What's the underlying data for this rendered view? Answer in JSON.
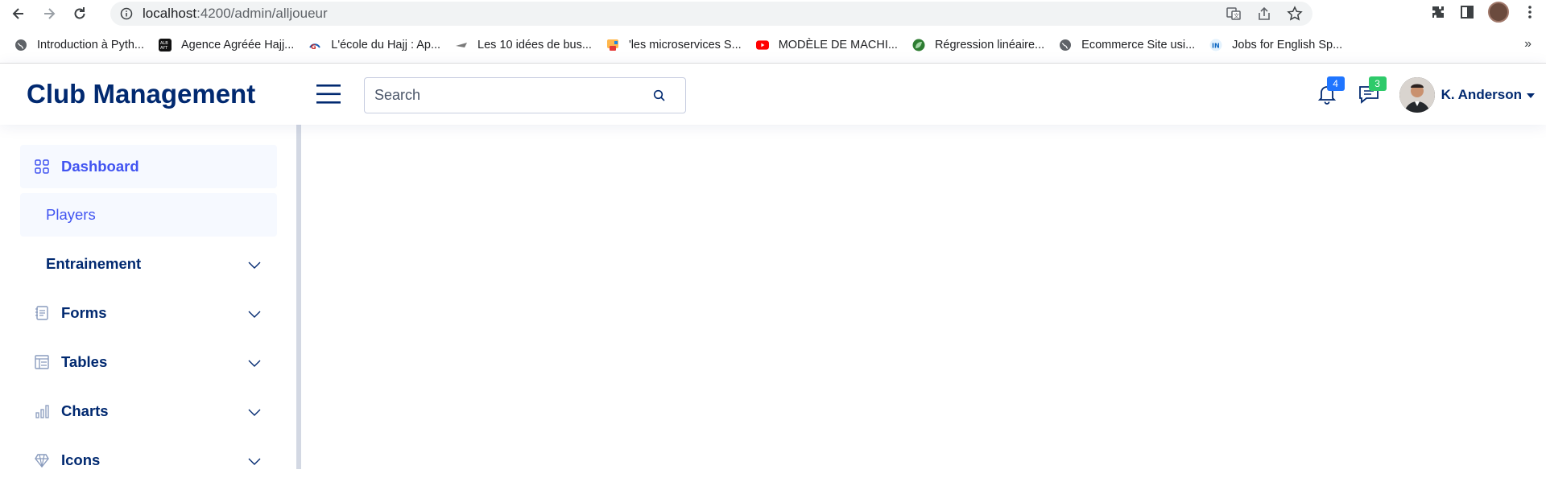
{
  "browser": {
    "url_host": "localhost",
    "url_rest": ":4200/admin/alljoueur",
    "bookmarks": [
      {
        "label": "Introduction à Pyth...",
        "icon": "globe-icon",
        "color": "#5f6368"
      },
      {
        "label": "Agence Agréée Hajj...",
        "icon": "alb-icon",
        "color": "#111111"
      },
      {
        "label": "L'école du Hajj : Ap...",
        "icon": "hajj-icon",
        "color": "#1a5fb4"
      },
      {
        "label": "Les 10 idées de bus...",
        "icon": "plane-icon",
        "color": "#7a7a7a"
      },
      {
        "label": "'les microservices S...",
        "icon": "slides-icon",
        "color": "#f57c00"
      },
      {
        "label": "MODÈLE DE MACHI...",
        "icon": "youtube-icon",
        "color": "#ff0000"
      },
      {
        "label": "Régression linéaire...",
        "icon": "leaf-icon",
        "color": "#2e7d32"
      },
      {
        "label": "Ecommerce Site usi...",
        "icon": "globe-icon",
        "color": "#5f6368"
      },
      {
        "label": "Jobs for English Sp...",
        "icon": "in-icon",
        "color": "#0a66c2"
      }
    ],
    "more": "»"
  },
  "header": {
    "logo": "Club Management",
    "search_placeholder": "Search",
    "notifications_count": "4",
    "messages_count": "3",
    "user_name": "K. Anderson"
  },
  "sidebar": {
    "items": [
      {
        "label": "Dashboard",
        "icon": "grid-icon"
      },
      {
        "label": "Players"
      },
      {
        "label": "Entrainement"
      },
      {
        "label": "Forms",
        "icon": "journal-icon"
      },
      {
        "label": "Tables",
        "icon": "table-icon"
      },
      {
        "label": "Charts",
        "icon": "bar-chart-icon"
      },
      {
        "label": "Icons",
        "icon": "gem-icon"
      }
    ]
  },
  "colors": {
    "primary": "#012970",
    "accent": "#4154f1",
    "active_bg": "#f6f9ff"
  }
}
